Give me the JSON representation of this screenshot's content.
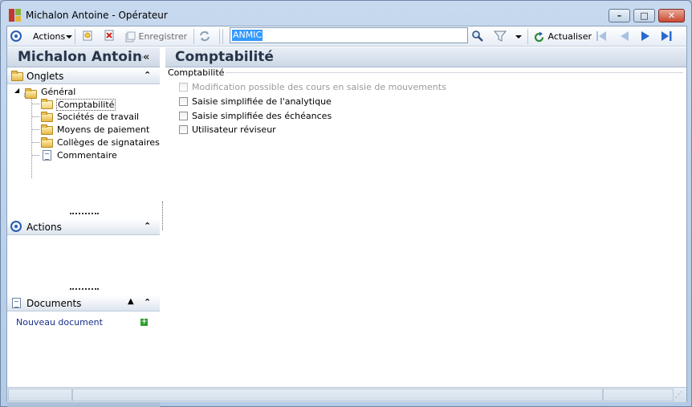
{
  "window": {
    "title": "Michalon Antoine -  Opérateur"
  },
  "toolbar": {
    "actions_label": "Actions",
    "save_label": "Enregistrer",
    "search_value": "ANMIC",
    "refresh_label": "Actualiser"
  },
  "left": {
    "person_name": "Michalon Antoine",
    "onglets": {
      "title": "Onglets",
      "root": "Général",
      "items": [
        "Comptabilité",
        "Sociétés de travail",
        "Moyens de paiement",
        "Collèges de signataires",
        "Commentaire"
      ]
    },
    "actions": {
      "title": "Actions"
    },
    "documents": {
      "title": "Documents",
      "new_doc": "Nouveau document"
    }
  },
  "main": {
    "title": "Comptabilité",
    "group_label": "Comptabilité",
    "options": [
      {
        "label": "Modification possible des cours en saisie de mouvements",
        "checked": false,
        "disabled": true
      },
      {
        "label": "Saisie simplifiée de l'analytique",
        "checked": false,
        "disabled": false
      },
      {
        "label": "Saisie simplifiée des échéances",
        "checked": false,
        "disabled": false
      },
      {
        "label": "Utilisateur réviseur",
        "checked": false,
        "disabled": false
      }
    ]
  },
  "colors": {
    "accent": "#2a5db0",
    "header_text": "#27354a",
    "selection": "#3399ff",
    "add_green": "#2ea12e"
  }
}
